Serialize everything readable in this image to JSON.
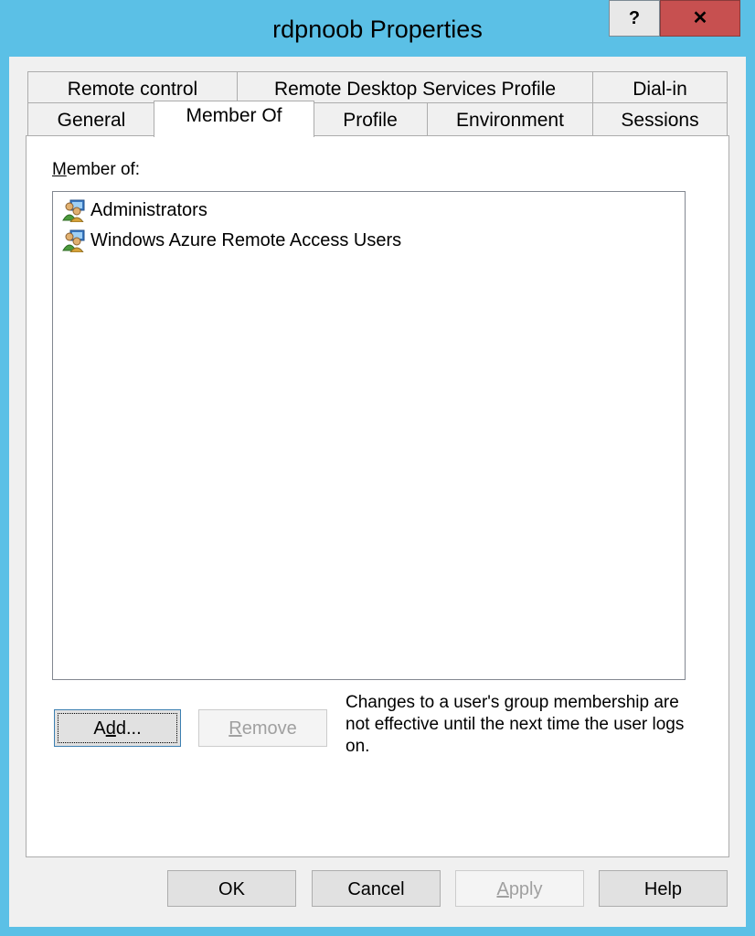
{
  "window": {
    "title": "rdpnoob Properties",
    "help_label": "?",
    "close_label": "✕"
  },
  "tabs": {
    "row1": [
      "Remote control",
      "Remote Desktop Services Profile",
      "Dial-in"
    ],
    "row2": [
      "General",
      "Member Of",
      "Profile",
      "Environment",
      "Sessions"
    ],
    "active": "Member Of"
  },
  "member_of": {
    "label_accel": "M",
    "label_rest": "ember of:",
    "items": [
      {
        "name": "Administrators",
        "icon": "group-icon"
      },
      {
        "name": "Windows Azure Remote Access Users",
        "icon": "group-icon"
      }
    ]
  },
  "actions": {
    "add_accel": "d",
    "add_pre": "A",
    "add_post": "d...",
    "remove_accel": "R",
    "remove_rest": "emove",
    "note": "Changes to a user's group membership are not effective until the next time the user logs on."
  },
  "footer": {
    "ok": "OK",
    "cancel": "Cancel",
    "apply_accel": "A",
    "apply_rest": "pply",
    "help": "Help"
  },
  "colors": {
    "frame": "#5bc0e6",
    "client": "#f0f0f0",
    "close": "#c75050"
  }
}
